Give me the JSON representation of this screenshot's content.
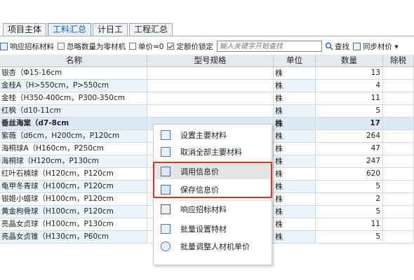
{
  "tabs": [
    "项目主体",
    "工料汇总",
    "计日工",
    "工程汇总"
  ],
  "active_tab": 1,
  "toolbar": {
    "respond_label": "响应招标材料",
    "ignore_zero_label": "忽略数量为零材机",
    "unit_price_zero_label": "单价=0",
    "quota_lock_label": "定额价锁定",
    "search_placeholder": "输入关键字开始查找",
    "find_label": "查找",
    "sync_label": "同步材价 ▾"
  },
  "columns": [
    "名称",
    "型号规格",
    "单位",
    "数量",
    "除税"
  ],
  "rows": [
    {
      "name": "银杏（Φ15-16cm",
      "spec": "",
      "unit": "株",
      "qty": "13"
    },
    {
      "name": "金桂A（H>550cm，P>550cm",
      "spec": "",
      "unit": "株",
      "qty": "4"
    },
    {
      "name": "金桂（H350-400cm，P300-350cm",
      "spec": "",
      "unit": "株",
      "qty": "11"
    },
    {
      "name": "红枫（d10-11cm",
      "spec": "",
      "unit": "株",
      "qty": "5"
    },
    {
      "name": "垂丝海棠（d7-8cm",
      "spec": "",
      "unit": "株",
      "qty": "17"
    },
    {
      "name": "紫薇（d6cm，H200cm，P120cm",
      "spec": "",
      "unit": "株",
      "qty": "264"
    },
    {
      "name": "海桐球A（H160cm，P250cm",
      "spec": "",
      "unit": "株",
      "qty": "47"
    },
    {
      "name": "海桐球（H120cm，P130cm",
      "spec": "",
      "unit": "株",
      "qty": "247"
    },
    {
      "name": "红叶石楠球（H120cm，P120cm",
      "spec": "",
      "unit": "株",
      "qty": "620"
    },
    {
      "name": "龟甲冬青球（H100cm，P120cm",
      "spec": "",
      "unit": "株",
      "qty": "5"
    },
    {
      "name": "银姬小蜡球（H100cm，P120cm",
      "spec": "",
      "unit": "株",
      "qty": "2"
    },
    {
      "name": "黄金枸骨球（H100cm，P120cm",
      "spec": "",
      "unit": "株",
      "qty": "5"
    },
    {
      "name": "亮晶女贞球（H100cm，P130cm",
      "spec": "",
      "unit": "株",
      "qty": "11"
    },
    {
      "name": "亮晶女贞锥（H130cm，P60cm",
      "spec": "",
      "unit": "株",
      "qty": "5"
    }
  ],
  "context_menu": [
    {
      "label": "设置主要材料",
      "icon": "set-main-material-icon"
    },
    {
      "label": "取消全部主要材料",
      "icon": "cancel-main-material-icon"
    },
    {
      "label": "调用信息价",
      "icon": "load-info-price-icon"
    },
    {
      "label": "保存信息价",
      "icon": "save-info-price-icon"
    },
    {
      "label": "响应招标材料",
      "icon": "respond-bid-material-icon"
    },
    {
      "label": "批量设置特材",
      "icon": "batch-special-material-icon"
    },
    {
      "label": "批量调整人材机单价",
      "icon": "batch-adjust-price-icon"
    }
  ]
}
